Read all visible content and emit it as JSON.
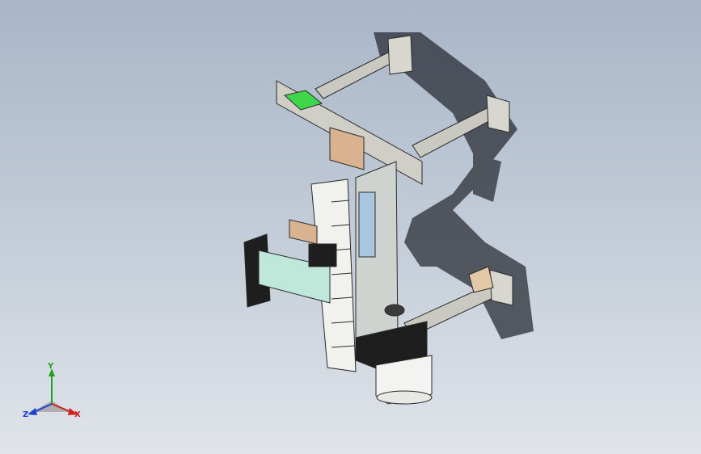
{
  "viewport": {
    "background_top": "#a9b6c8",
    "background_bottom": "#e0e4ea",
    "model": {
      "frame_color": "#c9c8c1",
      "edge_color": "#2b2b2b",
      "highlight_green": "#3fd64a",
      "plate_tan": "#d9b38f",
      "panel_aqua": "#bfe8da",
      "motor_black": "#1e1e1e",
      "shadow_color": "#2a2e35"
    }
  },
  "triad": {
    "x_label": "X",
    "y_label": "Y",
    "z_label": "Z",
    "x_color": "#d02020",
    "y_color": "#20a020",
    "z_color": "#2040d0"
  }
}
